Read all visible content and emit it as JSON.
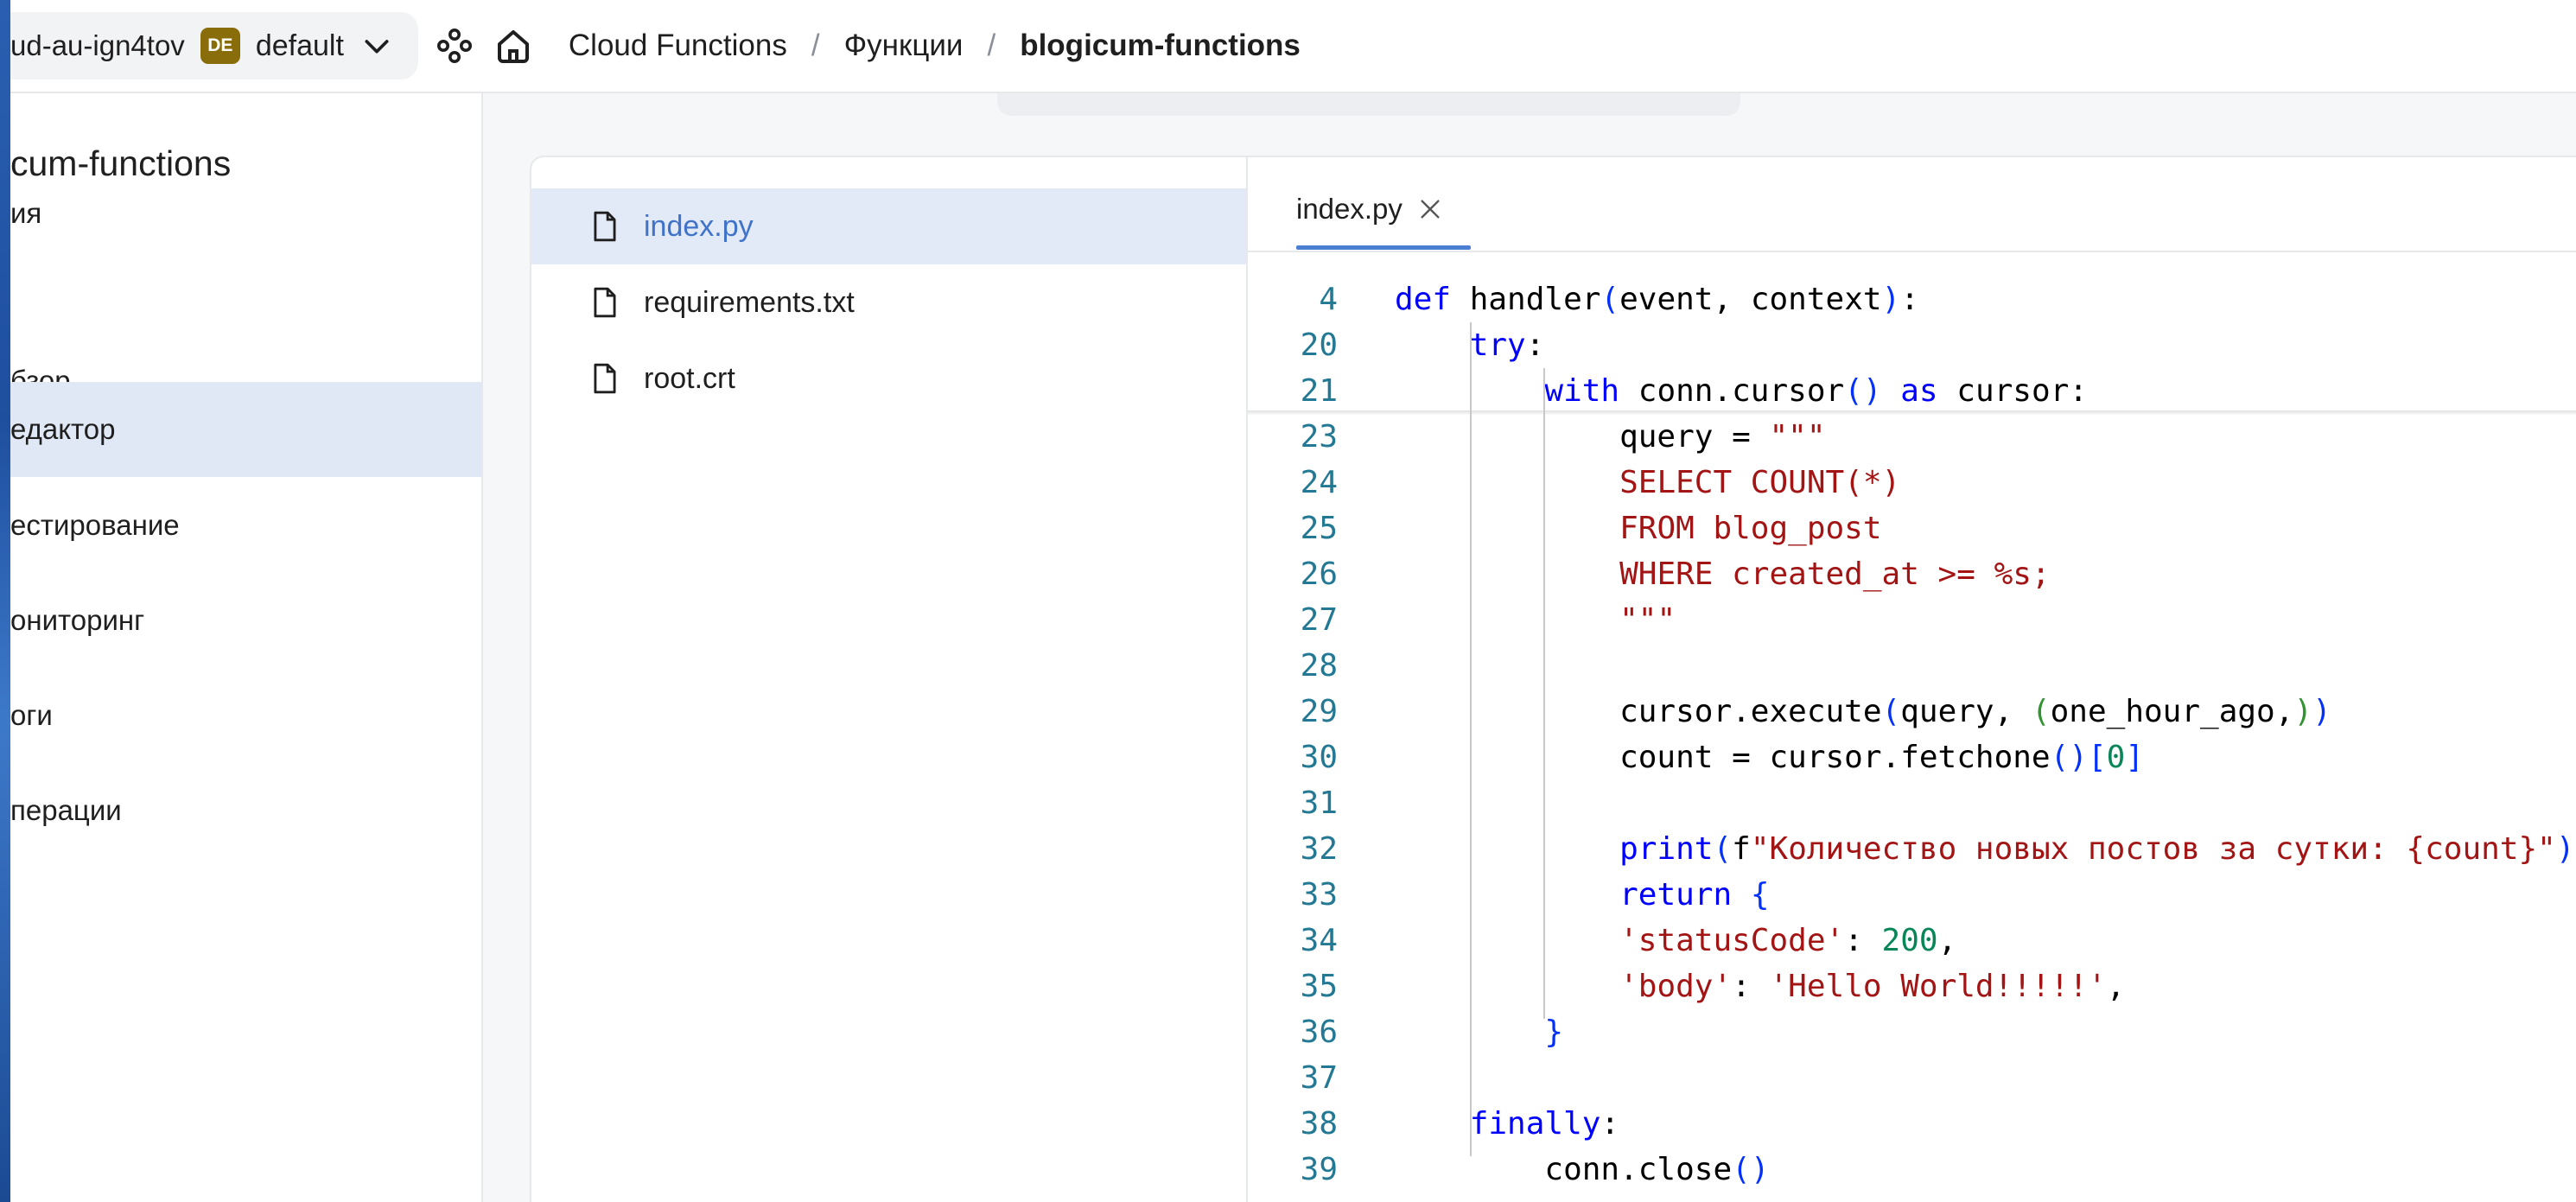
{
  "topbar": {
    "account_name": "ud-au-ign4tov",
    "folder_badge": "DE",
    "folder_name": "default",
    "breadcrumbs": [
      "Cloud Functions",
      "Функции",
      "blogicum-functions"
    ],
    "separator": "/"
  },
  "sidebar": {
    "function_title": "cum-functions",
    "function_subtitle": "ия",
    "items": [
      {
        "label": "бзор",
        "active": false
      },
      {
        "label": "едактор",
        "active": true
      },
      {
        "label": "естирование",
        "active": false
      },
      {
        "label": "ониторинг",
        "active": false
      },
      {
        "label": "оги",
        "active": false
      },
      {
        "label": "перации",
        "active": false
      }
    ]
  },
  "files": [
    {
      "name": "index.py",
      "active": true
    },
    {
      "name": "requirements.txt",
      "active": false
    },
    {
      "name": "root.crt",
      "active": false
    }
  ],
  "editor": {
    "tab_label": "index.py",
    "lines": [
      {
        "n": "4",
        "html": "<span class=\"kw\">def</span> handler<span class=\"br1\">(</span>event, context<span class=\"br1\">)</span>:"
      },
      {
        "n": "20",
        "html": "    <span class=\"kw\">try</span>:"
      },
      {
        "n": "21",
        "html": "        <span class=\"kw\">with</span> conn.cursor<span class=\"br1\">()</span> <span class=\"kw\">as</span> cursor:"
      },
      {
        "n": "23",
        "html": "            query = <span class=\"str\">\"\"\"</span>"
      },
      {
        "n": "24",
        "html": "            <span class=\"str\">SELECT COUNT(*)</span>"
      },
      {
        "n": "25",
        "html": "            <span class=\"str\">FROM blog_post</span>"
      },
      {
        "n": "26",
        "html": "            <span class=\"str\">WHERE created_at &gt;= %s;</span>"
      },
      {
        "n": "27",
        "html": "            <span class=\"str\">\"\"\"</span>"
      },
      {
        "n": "28",
        "html": ""
      },
      {
        "n": "29",
        "html": "            cursor.execute<span class=\"br1\">(</span>query, <span class=\"br2\">(</span>one_hour_ago,<span class=\"br2\">)</span><span class=\"br1\">)</span>"
      },
      {
        "n": "30",
        "html": "            count = cursor.fetchone<span class=\"br1\">()[</span><span class=\"num\">0</span><span class=\"br1\">]</span>"
      },
      {
        "n": "31",
        "html": ""
      },
      {
        "n": "32",
        "html": "            <span class=\"kw\">print</span><span class=\"br1\">(</span>f<span class=\"str\">\"Количество новых постов за сутки: {count}\"</span><span class=\"br1\">)</span>"
      },
      {
        "n": "33",
        "html": "            <span class=\"kw\">return</span> <span class=\"br1\">{</span>"
      },
      {
        "n": "34",
        "html": "            <span class=\"str\">'statusCode'</span>: <span class=\"num\">200</span>,"
      },
      {
        "n": "35",
        "html": "            <span class=\"str\">'body'</span>: <span class=\"str\">'Hello World!!!!!'</span>,"
      },
      {
        "n": "36",
        "html": "        <span class=\"br1\">}</span>"
      },
      {
        "n": "37",
        "html": ""
      },
      {
        "n": "38",
        "html": "    <span class=\"kw\">finally</span>:"
      },
      {
        "n": "39",
        "html": "        conn.close<span class=\"br1\">()</span>"
      }
    ]
  },
  "colors": {
    "folder_badge_bg": "#8a6d0b",
    "accent": "#4a7fd4",
    "active_nav_bg": "#e0e7f5"
  }
}
